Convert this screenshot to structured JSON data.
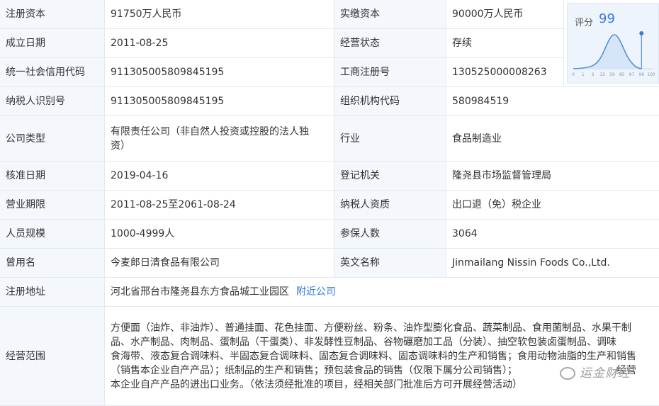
{
  "rows": {
    "reg_capital": {
      "label": "注册资本",
      "value": "91750万人民币"
    },
    "paid_capital": {
      "label": "实缴资本",
      "value": "90000万人民币"
    },
    "founded": {
      "label": "成立日期",
      "value": "2011-08-25"
    },
    "status": {
      "label": "经营状态",
      "value": "存续"
    },
    "credit_code": {
      "label": "统一社会信用代码",
      "value": "911305005809845195"
    },
    "biz_reg_no": {
      "label": "工商注册号",
      "value": "130525000008263"
    },
    "taxpayer_id": {
      "label": "纳税人识别号",
      "value": "911305005809845195"
    },
    "org_code": {
      "label": "组织机构代码",
      "value": "580984519"
    },
    "company_type": {
      "label": "公司类型",
      "value_line1": "有限责任公司（非自然人投资或控股的法人独",
      "value_line2": "资）"
    },
    "industry": {
      "label": "行业",
      "value": "食品制造业"
    },
    "approval_date": {
      "label": "核准日期",
      "value": "2019-04-16"
    },
    "reg_authority": {
      "label": "登记机关",
      "value": "隆尧县市场监督管理局"
    },
    "biz_term": {
      "label": "营业期限",
      "value": "2011-08-25至2061-08-24"
    },
    "taxpayer_quali": {
      "label": "纳税人资质",
      "value": "出口退（免）税企业"
    },
    "staff_size": {
      "label": "人员规模",
      "value": "1000-4999人"
    },
    "insured": {
      "label": "参保人数",
      "value": "3064"
    },
    "former_name": {
      "label": "曾用名",
      "value": "今麦郎日清食品有限公司"
    },
    "english_name": {
      "label": "英文名称",
      "value": "Jinmailang Nissin Foods Co.,Ltd."
    },
    "reg_address": {
      "label": "注册地址",
      "value": "河北省邢台市隆尧县东方食品城工业园区",
      "link": "附近公司"
    },
    "biz_scope": {
      "label": "经营范围",
      "lines": [
        "方便面（油炸、非油炸）、普通挂面、花色挂面、方便粉丝、粉条、油炸型膨化食品、蔬菜制品、食用菌制品、水果干制",
        "品、水产制品、肉制品、蛋制品（干蛋类）、非发酵性豆制品、谷物碾磨加工品（分装）、抽空软包装卤蛋制品、调味",
        "食海带、液态复合调味料、半固态复合调味料、固态复合调味料、固态调味料的生产和销售；食用动物油脂的生产和销售",
        "（销售本企业自产产品）；纸制品的生产和销售；预包装食品的销售（仅限下属分公司销售）；",
        "本企业自产产品的进出口业务。（依法须经批准的项目，经相关部门批准后方可开展经营活动）"
      ]
    }
  },
  "score": {
    "label": "评分",
    "value": "99",
    "ticks": [
      "0",
      "1",
      "3",
      "15",
      "50",
      "85",
      "97",
      "99",
      "100"
    ],
    "level": 99
  },
  "watermark": {
    "text": "运金财经",
    "trailing_text": "经营"
  },
  "colors": {
    "label_bg": "#f4f7fb",
    "border": "#e4e8ef",
    "link": "#2f7bd8",
    "score": "#3b78d8"
  }
}
